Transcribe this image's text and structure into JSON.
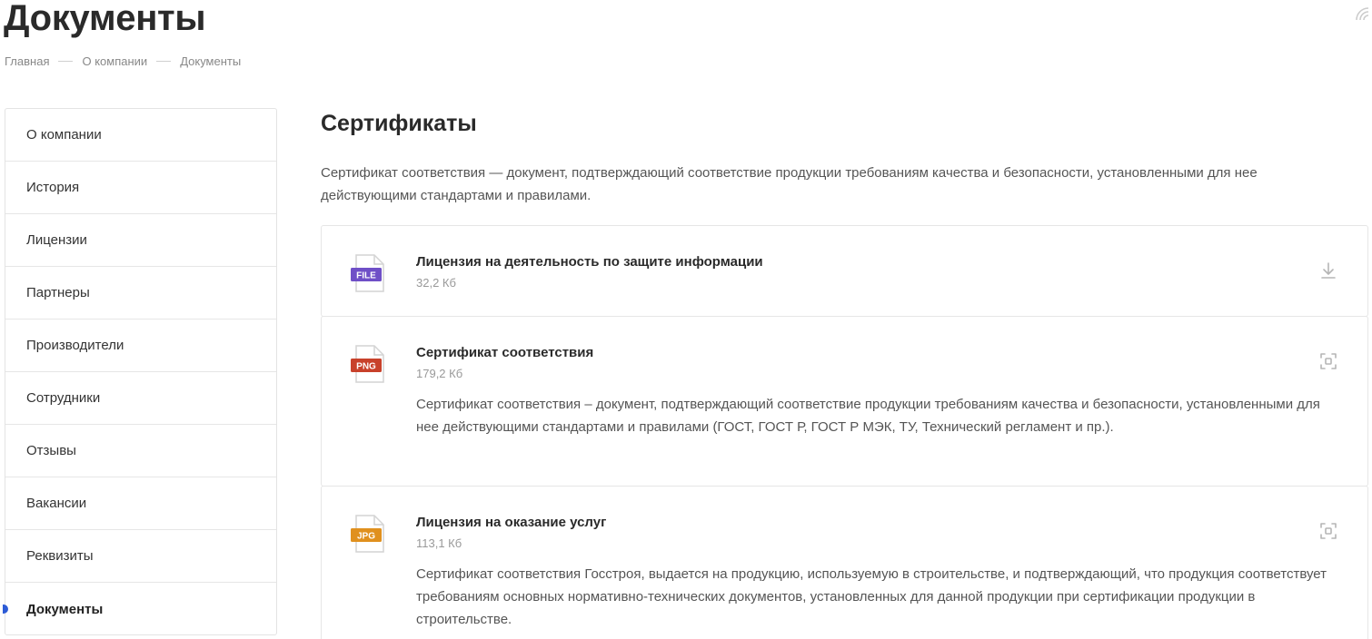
{
  "page": {
    "title": "Документы"
  },
  "breadcrumb": [
    "Главная",
    "О компании",
    "Документы"
  ],
  "sidebar": {
    "items": [
      {
        "label": "О компании"
      },
      {
        "label": "История"
      },
      {
        "label": "Лицензии"
      },
      {
        "label": "Партнеры"
      },
      {
        "label": "Производители"
      },
      {
        "label": "Сотрудники"
      },
      {
        "label": "Отзывы"
      },
      {
        "label": "Вакансии"
      },
      {
        "label": "Реквизиты"
      },
      {
        "label": "Документы",
        "active": true
      }
    ]
  },
  "section": {
    "title": "Сертификаты",
    "intro": "Сертификат соответствия — документ, подтверждающий соответствие продукции требованиям качества и безопасности, установленными для нее действующими стандартами и правилами."
  },
  "documents": [
    {
      "badge": "FILE",
      "badge_color": "#6f4fc7",
      "name": "Лицензия на деятельность по защите информации",
      "size": "32,2 Кб",
      "action_icon": "download-icon"
    },
    {
      "badge": "PNG",
      "badge_color": "#c8412b",
      "name": "Сертификат соответствия",
      "size": "179,2 Кб",
      "description": "Сертификат соответствия – документ, подтверждающий соответствие продукции требованиям качества и безопасности, установленными для нее действующими стандартами и правилами (ГОСТ, ГОСТ Р, ГОСТ Р МЭК, ТУ, Технический регламент и пр.).",
      "action_icon": "zoom-icon"
    },
    {
      "badge": "JPG",
      "badge_color": "#e0901e",
      "name": "Лицензия на оказание услуг",
      "size": "113,1 Кб",
      "description": "Сертификат соответствия Госстроя, выдается на продукцию, используемую в строительстве, и подтверждающий, что продукция соответствует требованиям основных нормативно-технических документов, установленных для данной продукции при сертификации продукции в строительстве.",
      "action_icon": "zoom-icon"
    }
  ],
  "colors": {
    "accent": "#2d5bd6",
    "border": "#e6e6e6"
  }
}
